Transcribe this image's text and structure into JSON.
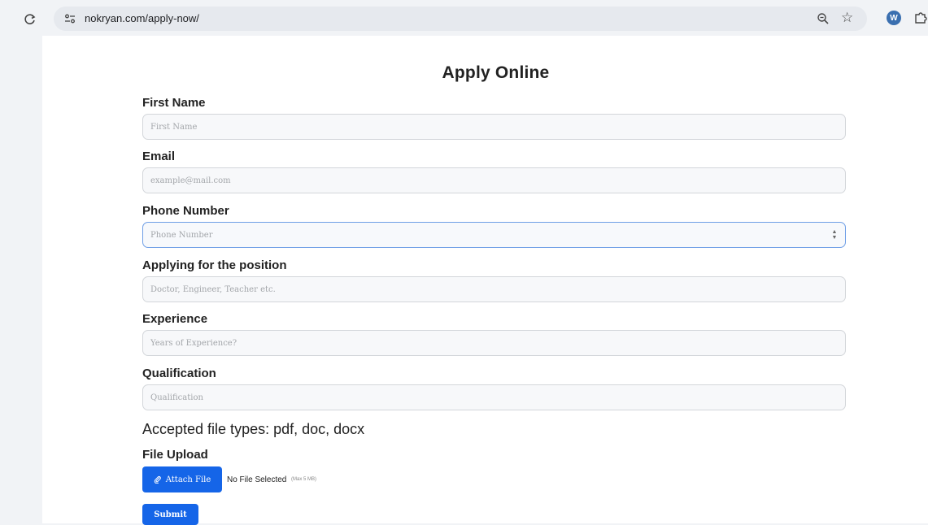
{
  "browser": {
    "url": "nokryan.com/apply-now/",
    "reload_icon": "reload-icon",
    "site_info_icon": "site-info-icon",
    "zoom_icon": "zoom-icon",
    "bookmark_icon": "star-icon",
    "extension_icon": "wordpress-icon",
    "extensions_menu_icon": "puzzle-icon"
  },
  "form": {
    "title": "Apply Online",
    "fields": [
      {
        "label": "First Name",
        "placeholder": "First Name",
        "value": ""
      },
      {
        "label": "Email",
        "placeholder": "example@mail.com",
        "value": ""
      },
      {
        "label": "Phone Number",
        "placeholder": "Phone Number",
        "value": ""
      },
      {
        "label": "Applying for the position",
        "placeholder": "Doctor, Engineer, Teacher etc.",
        "value": ""
      },
      {
        "label": "Experience",
        "placeholder": "Years of Experience?",
        "value": ""
      },
      {
        "label": "Qualification",
        "placeholder": "Qualification",
        "value": ""
      }
    ],
    "file_types_note": "Accepted file types: pdf, doc, docx",
    "file_upload_label": "File Upload",
    "attach_button_label": "Attach File",
    "no_file_text": "No File Selected",
    "max_size_text": "(Max 5 MB)",
    "submit_label": "Submit"
  },
  "colors": {
    "accent": "#1565e8",
    "focus_border": "#6e9ee6"
  }
}
